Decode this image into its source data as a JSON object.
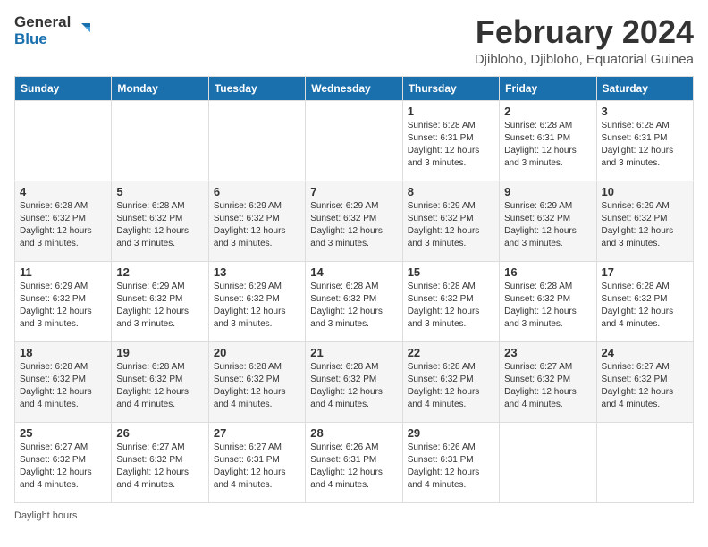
{
  "logo": {
    "text_general": "General",
    "text_blue": "Blue"
  },
  "header": {
    "month_year": "February 2024",
    "location": "Djibloho, Djibloho, Equatorial Guinea"
  },
  "weekdays": [
    "Sunday",
    "Monday",
    "Tuesday",
    "Wednesday",
    "Thursday",
    "Friday",
    "Saturday"
  ],
  "weeks": [
    [
      {
        "day": "",
        "info": ""
      },
      {
        "day": "",
        "info": ""
      },
      {
        "day": "",
        "info": ""
      },
      {
        "day": "",
        "info": ""
      },
      {
        "day": "1",
        "info": "Sunrise: 6:28 AM\nSunset: 6:31 PM\nDaylight: 12 hours and 3 minutes."
      },
      {
        "day": "2",
        "info": "Sunrise: 6:28 AM\nSunset: 6:31 PM\nDaylight: 12 hours and 3 minutes."
      },
      {
        "day": "3",
        "info": "Sunrise: 6:28 AM\nSunset: 6:31 PM\nDaylight: 12 hours and 3 minutes."
      }
    ],
    [
      {
        "day": "4",
        "info": "Sunrise: 6:28 AM\nSunset: 6:32 PM\nDaylight: 12 hours and 3 minutes."
      },
      {
        "day": "5",
        "info": "Sunrise: 6:28 AM\nSunset: 6:32 PM\nDaylight: 12 hours and 3 minutes."
      },
      {
        "day": "6",
        "info": "Sunrise: 6:29 AM\nSunset: 6:32 PM\nDaylight: 12 hours and 3 minutes."
      },
      {
        "day": "7",
        "info": "Sunrise: 6:29 AM\nSunset: 6:32 PM\nDaylight: 12 hours and 3 minutes."
      },
      {
        "day": "8",
        "info": "Sunrise: 6:29 AM\nSunset: 6:32 PM\nDaylight: 12 hours and 3 minutes."
      },
      {
        "day": "9",
        "info": "Sunrise: 6:29 AM\nSunset: 6:32 PM\nDaylight: 12 hours and 3 minutes."
      },
      {
        "day": "10",
        "info": "Sunrise: 6:29 AM\nSunset: 6:32 PM\nDaylight: 12 hours and 3 minutes."
      }
    ],
    [
      {
        "day": "11",
        "info": "Sunrise: 6:29 AM\nSunset: 6:32 PM\nDaylight: 12 hours and 3 minutes."
      },
      {
        "day": "12",
        "info": "Sunrise: 6:29 AM\nSunset: 6:32 PM\nDaylight: 12 hours and 3 minutes."
      },
      {
        "day": "13",
        "info": "Sunrise: 6:29 AM\nSunset: 6:32 PM\nDaylight: 12 hours and 3 minutes."
      },
      {
        "day": "14",
        "info": "Sunrise: 6:28 AM\nSunset: 6:32 PM\nDaylight: 12 hours and 3 minutes."
      },
      {
        "day": "15",
        "info": "Sunrise: 6:28 AM\nSunset: 6:32 PM\nDaylight: 12 hours and 3 minutes."
      },
      {
        "day": "16",
        "info": "Sunrise: 6:28 AM\nSunset: 6:32 PM\nDaylight: 12 hours and 3 minutes."
      },
      {
        "day": "17",
        "info": "Sunrise: 6:28 AM\nSunset: 6:32 PM\nDaylight: 12 hours and 4 minutes."
      }
    ],
    [
      {
        "day": "18",
        "info": "Sunrise: 6:28 AM\nSunset: 6:32 PM\nDaylight: 12 hours and 4 minutes."
      },
      {
        "day": "19",
        "info": "Sunrise: 6:28 AM\nSunset: 6:32 PM\nDaylight: 12 hours and 4 minutes."
      },
      {
        "day": "20",
        "info": "Sunrise: 6:28 AM\nSunset: 6:32 PM\nDaylight: 12 hours and 4 minutes."
      },
      {
        "day": "21",
        "info": "Sunrise: 6:28 AM\nSunset: 6:32 PM\nDaylight: 12 hours and 4 minutes."
      },
      {
        "day": "22",
        "info": "Sunrise: 6:28 AM\nSunset: 6:32 PM\nDaylight: 12 hours and 4 minutes."
      },
      {
        "day": "23",
        "info": "Sunrise: 6:27 AM\nSunset: 6:32 PM\nDaylight: 12 hours and 4 minutes."
      },
      {
        "day": "24",
        "info": "Sunrise: 6:27 AM\nSunset: 6:32 PM\nDaylight: 12 hours and 4 minutes."
      }
    ],
    [
      {
        "day": "25",
        "info": "Sunrise: 6:27 AM\nSunset: 6:32 PM\nDaylight: 12 hours and 4 minutes."
      },
      {
        "day": "26",
        "info": "Sunrise: 6:27 AM\nSunset: 6:32 PM\nDaylight: 12 hours and 4 minutes."
      },
      {
        "day": "27",
        "info": "Sunrise: 6:27 AM\nSunset: 6:31 PM\nDaylight: 12 hours and 4 minutes."
      },
      {
        "day": "28",
        "info": "Sunrise: 6:26 AM\nSunset: 6:31 PM\nDaylight: 12 hours and 4 minutes."
      },
      {
        "day": "29",
        "info": "Sunrise: 6:26 AM\nSunset: 6:31 PM\nDaylight: 12 hours and 4 minutes."
      },
      {
        "day": "",
        "info": ""
      },
      {
        "day": "",
        "info": ""
      }
    ]
  ],
  "footer": {
    "note": "Daylight hours"
  }
}
